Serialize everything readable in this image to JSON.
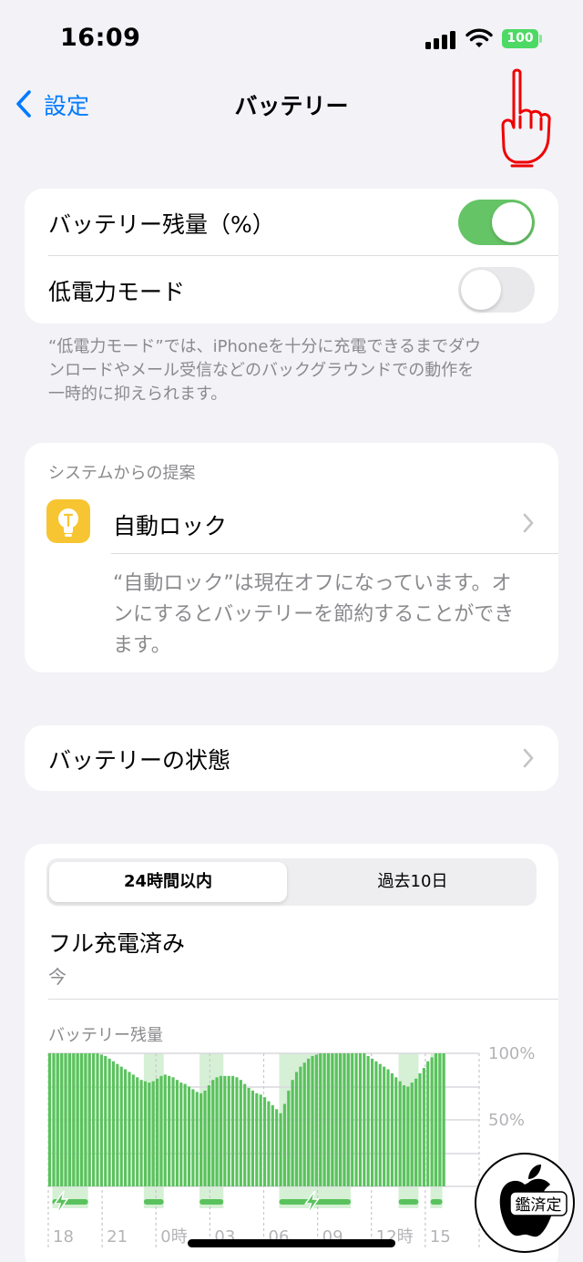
{
  "status_bar": {
    "time": "16:09",
    "battery_level": "100"
  },
  "nav": {
    "back_label": "設定",
    "title": "バッテリー"
  },
  "settings": {
    "battery_percentage": {
      "label": "バッテリー残量（%）",
      "on": true
    },
    "low_power_mode": {
      "label": "低電力モード",
      "on": false
    },
    "low_power_footnote": [
      "“低電力モード”では、iPhoneを十分に充電できるまでダウ",
      "ンロードやメール受信などのバックグラウンドでの動作を",
      "一時的に抑えられます。"
    ]
  },
  "suggestions": {
    "header": "システムからの提案",
    "item_label": "自動ロック",
    "description": [
      "“自動ロック”は現在オフになっています。オ",
      "ンにするとバッテリーを節約することができ",
      "ます。"
    ]
  },
  "battery_health": {
    "label": "バッテリーの状態"
  },
  "usage": {
    "tabs": [
      {
        "label": "24時間以内",
        "selected": true
      },
      {
        "label": "過去10日",
        "selected": false
      }
    ],
    "charge_status": "フル充電済み",
    "charge_time": "今"
  },
  "colors": {
    "accent": "#007aff",
    "toggle_on": "#65c466",
    "bar": "#5ac25d",
    "charging_bg": "#d6f0d6",
    "chart_line": "#d9d9dd"
  },
  "chart_data": {
    "type": "bar",
    "title": "バッテリー残量",
    "ylim": [
      0,
      100
    ],
    "y_ticks": [
      "100%",
      "50%"
    ],
    "x_tick_labels": [
      "18",
      "21",
      "0時",
      "03",
      "06",
      "09",
      "12時",
      "15"
    ],
    "values": [
      100,
      100,
      100,
      100,
      100,
      100,
      100,
      100,
      100,
      100,
      100,
      100,
      100,
      99,
      98,
      96,
      94,
      92,
      90,
      88,
      86,
      84,
      82,
      80,
      79,
      78,
      79,
      81,
      83,
      84,
      83,
      82,
      80,
      78,
      77,
      75,
      73,
      71,
      70,
      72,
      76,
      80,
      82,
      83,
      83,
      83,
      83,
      82,
      80,
      77,
      74,
      72,
      70,
      69,
      67,
      64,
      61,
      58,
      55,
      62,
      72,
      80,
      86,
      90,
      93,
      96,
      98,
      99,
      100,
      100,
      100,
      100,
      100,
      100,
      100,
      100,
      100,
      100,
      100,
      100,
      98,
      96,
      94,
      92,
      90,
      88,
      85,
      82,
      79,
      76,
      75,
      78,
      81,
      85,
      89,
      94,
      97,
      100,
      100,
      100
    ],
    "charging_periods": [
      [
        1,
        9
      ],
      [
        24,
        28
      ],
      [
        38,
        43
      ],
      [
        58,
        75
      ],
      [
        88,
        92
      ],
      [
        96,
        98
      ]
    ],
    "charging_icons": [
      3,
      66
    ]
  },
  "watermark": {
    "seal_text": "鑑済定"
  }
}
